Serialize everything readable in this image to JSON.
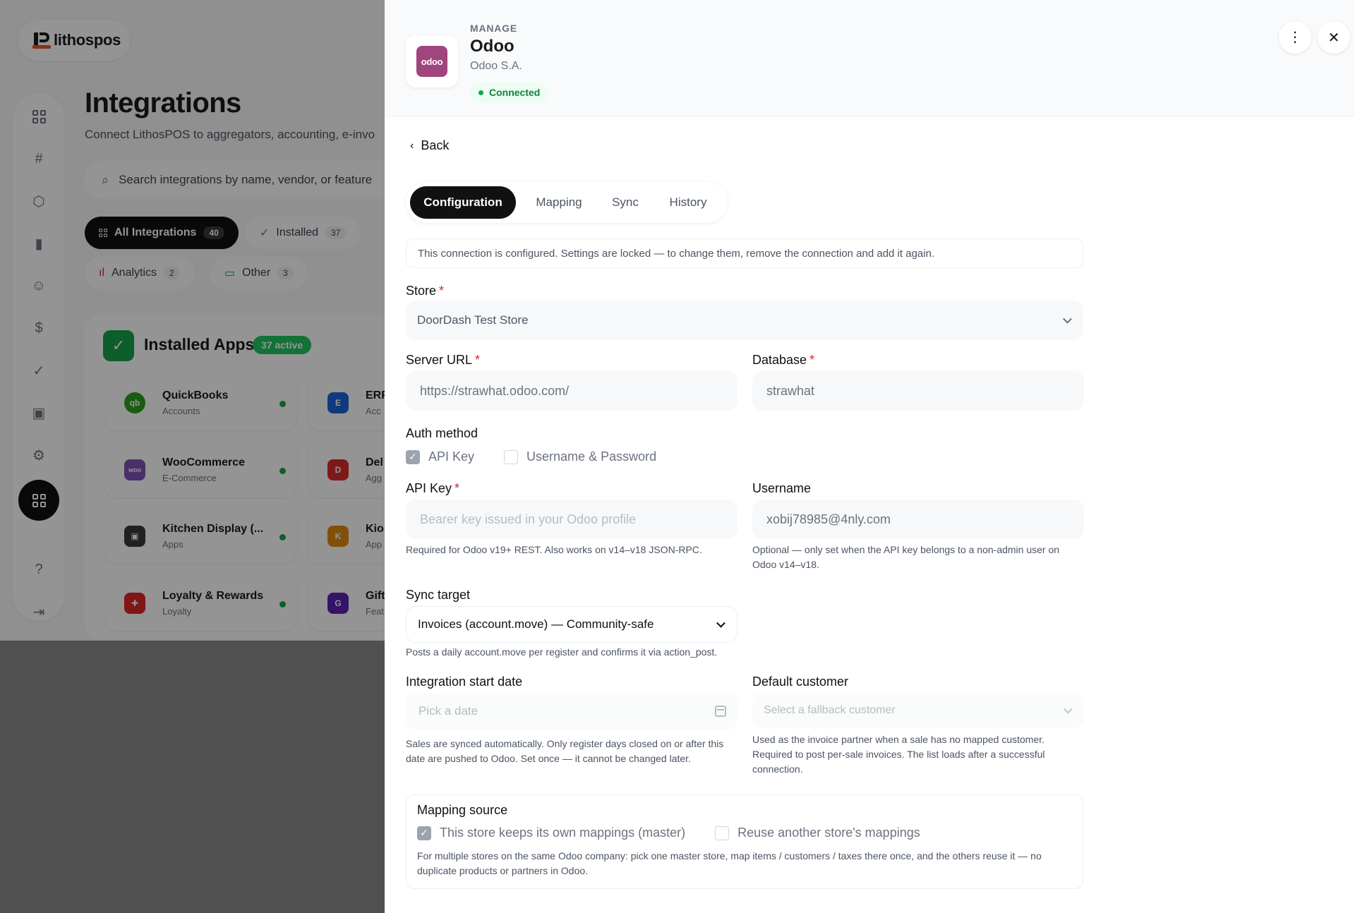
{
  "background": {
    "brand": "lithospos",
    "page_title": "Integrations",
    "page_subtitle": "Connect LithosPOS to aggregators, accounting, e-invo",
    "search_placeholder": "Search integrations by name, vendor, or feature",
    "filters": [
      {
        "label": "All Integrations",
        "count": "40"
      },
      {
        "label": "Installed",
        "count": "37"
      },
      {
        "label": "Analytics",
        "count": "2"
      },
      {
        "label": "Other",
        "count": "3"
      }
    ],
    "installed": {
      "title": "Installed Apps",
      "badge": "37 active",
      "apps": [
        {
          "name": "QuickBooks",
          "category": "Accounts",
          "icon": "qb",
          "color": "#2ca01c"
        },
        {
          "name": "WooCommerce",
          "category": "E-Commerce",
          "icon": "woo",
          "color": "#7f54b3"
        },
        {
          "name": "Kitchen Display (...",
          "category": "Apps",
          "icon": "kds",
          "color": "#3a3a3a"
        },
        {
          "name": "Loyalty & Rewards",
          "category": "Loyalty",
          "icon": "gift",
          "color": "#dc2626"
        },
        {
          "name": "ERP",
          "category": "Acc",
          "icon": "E",
          "color": "#1d64d8"
        },
        {
          "name": "Del",
          "category": "Agg",
          "icon": "D",
          "color": "#d92b2b"
        },
        {
          "name": "Kio",
          "category": "App",
          "icon": "K",
          "color": "#e28a12"
        },
        {
          "name": "Gift",
          "category": "Feat",
          "icon": "G",
          "color": "#5b21b6"
        }
      ]
    }
  },
  "drawer": {
    "eyebrow": "MANAGE",
    "title": "Odoo",
    "vendor": "Odoo S.A.",
    "logo_text": "odoo",
    "logo_color": "#a1457f",
    "status": "Connected",
    "back_label": "Back",
    "tabs": [
      "Configuration",
      "Mapping",
      "Sync",
      "History"
    ],
    "notice": "This connection is configured. Settings are locked — to change them, remove the connection and add it again.",
    "store": {
      "label": "Store",
      "value": "DoorDash Test Store"
    },
    "server_url": {
      "label": "Server URL",
      "value": "https://strawhat.odoo.com/"
    },
    "database": {
      "label": "Database",
      "value": "strawhat"
    },
    "auth": {
      "label": "Auth method",
      "options": [
        "API Key",
        "Username & Password"
      ]
    },
    "api_key": {
      "label": "API Key",
      "placeholder": "Bearer key issued in your Odoo profile",
      "help": "Required for Odoo v19+ REST. Also works on v14–v18 JSON-RPC."
    },
    "username": {
      "label": "Username",
      "value": "xobij78985@4nly.com",
      "help": "Optional — only set when the API key belongs to a non-admin user on Odoo v14–v18."
    },
    "sync_target": {
      "label": "Sync target",
      "value": "Invoices (account.move) — Community-safe",
      "help": "Posts a daily account.move per register and confirms it via action_post."
    },
    "start_date": {
      "label": "Integration start date",
      "placeholder": "Pick a date",
      "help": "Sales are synced automatically. Only register days closed on or after this date are pushed to Odoo. Set once — it cannot be changed later."
    },
    "default_customer": {
      "label": "Default customer",
      "placeholder": "Select a fallback customer",
      "help": "Used as the invoice partner when a sale has no mapped customer. Required to post per-sale invoices. The list loads after a successful connection."
    },
    "mapping_source": {
      "label": "Mapping source",
      "options": [
        "This store keeps its own mappings (master)",
        "Reuse another store's mappings"
      ],
      "help": "For multiple stores on the same Odoo company: pick one master store, map items / customers / taxes there once, and the others reuse it — no duplicate products or partners in Odoo."
    }
  }
}
